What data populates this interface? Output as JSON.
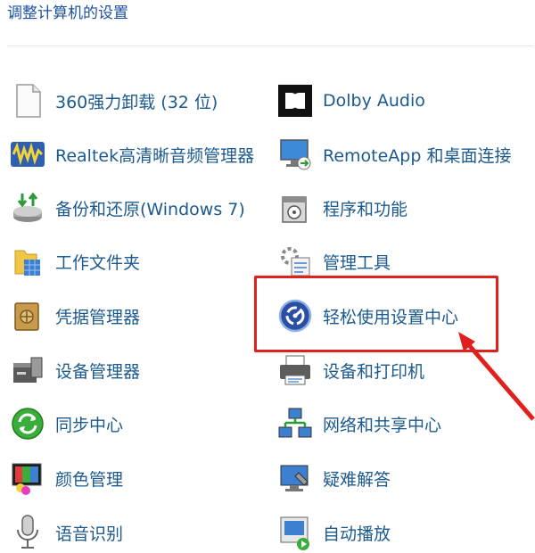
{
  "header": {
    "title": "调整计算机的设置"
  },
  "items": [
    {
      "label": "360强力卸载 (32 位)",
      "icon": "blank-document-icon"
    },
    {
      "label": "Dolby Audio",
      "icon": "dolby-icon"
    },
    {
      "label": "Realtek高清晰音频管理器",
      "icon": "audio-waveform-icon"
    },
    {
      "label": "RemoteApp 和桌面连接",
      "icon": "remote-desktop-icon"
    },
    {
      "label": "备份和还原(Windows 7)",
      "icon": "backup-restore-icon"
    },
    {
      "label": "程序和功能",
      "icon": "programs-icon"
    },
    {
      "label": "工作文件夹",
      "icon": "work-folders-icon"
    },
    {
      "label": "管理工具",
      "icon": "admin-tools-icon"
    },
    {
      "label": "凭据管理器",
      "icon": "credential-safe-icon"
    },
    {
      "label": "轻松使用设置中心",
      "icon": "ease-of-access-icon"
    },
    {
      "label": "设备管理器",
      "icon": "device-manager-icon"
    },
    {
      "label": "设备和打印机",
      "icon": "printer-icon"
    },
    {
      "label": "同步中心",
      "icon": "sync-icon"
    },
    {
      "label": "网络和共享中心",
      "icon": "network-icon"
    },
    {
      "label": "颜色管理",
      "icon": "color-management-icon"
    },
    {
      "label": "疑难解答",
      "icon": "troubleshoot-icon"
    },
    {
      "label": "语音识别",
      "icon": "microphone-icon"
    },
    {
      "label": "自动播放",
      "icon": "autoplay-icon"
    }
  ],
  "annotation": {
    "color": "#e0201d",
    "highlighted": "轻松使用设置中心"
  }
}
